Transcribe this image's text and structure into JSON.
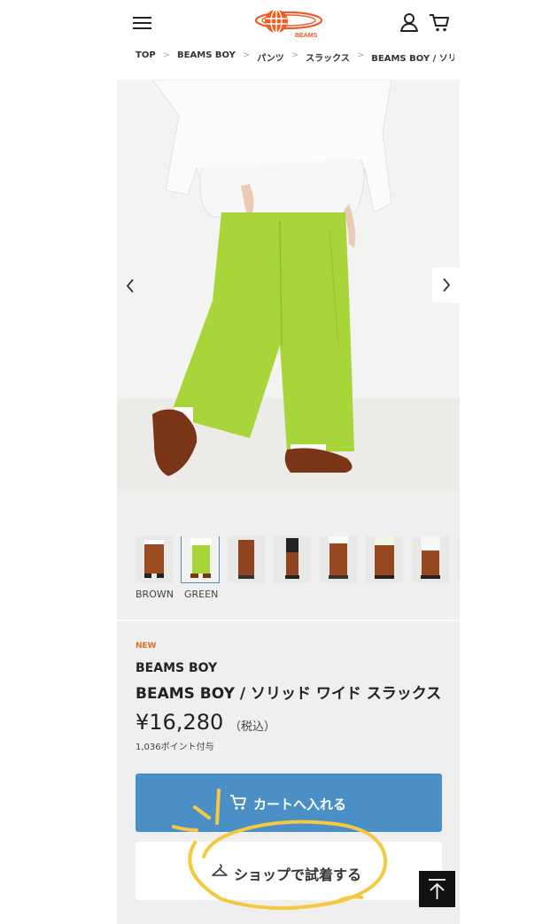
{
  "header": {
    "logo_text": "BEAMS",
    "icons": [
      "hamburger-menu-icon",
      "user-icon",
      "cart-icon"
    ]
  },
  "breadcrumb": [
    "TOP",
    "BEAMS BOY",
    "パンツ",
    "スラックス",
    "BEAMS BOY / ソリ…"
  ],
  "gallery": {
    "colors": [
      "BROWN",
      "GREEN"
    ],
    "selected_color": "GREEN"
  },
  "product": {
    "badge": "NEW",
    "brand": "BEAMS BOY",
    "name": "BEAMS BOY / ソリッド ワイド スラックス",
    "price": "¥16,280",
    "tax_note": "（税込）",
    "points": "1,036ポイント付与"
  },
  "actions": {
    "add_to_cart": "カートへ入れる",
    "try_in_shop": "ショップで試着する"
  },
  "colors": {
    "accent_blue": "#4a90c7",
    "new_badge": "#e46b2c",
    "logo_orange": "#f05a23",
    "annotation_yellow": "#f5c842"
  }
}
